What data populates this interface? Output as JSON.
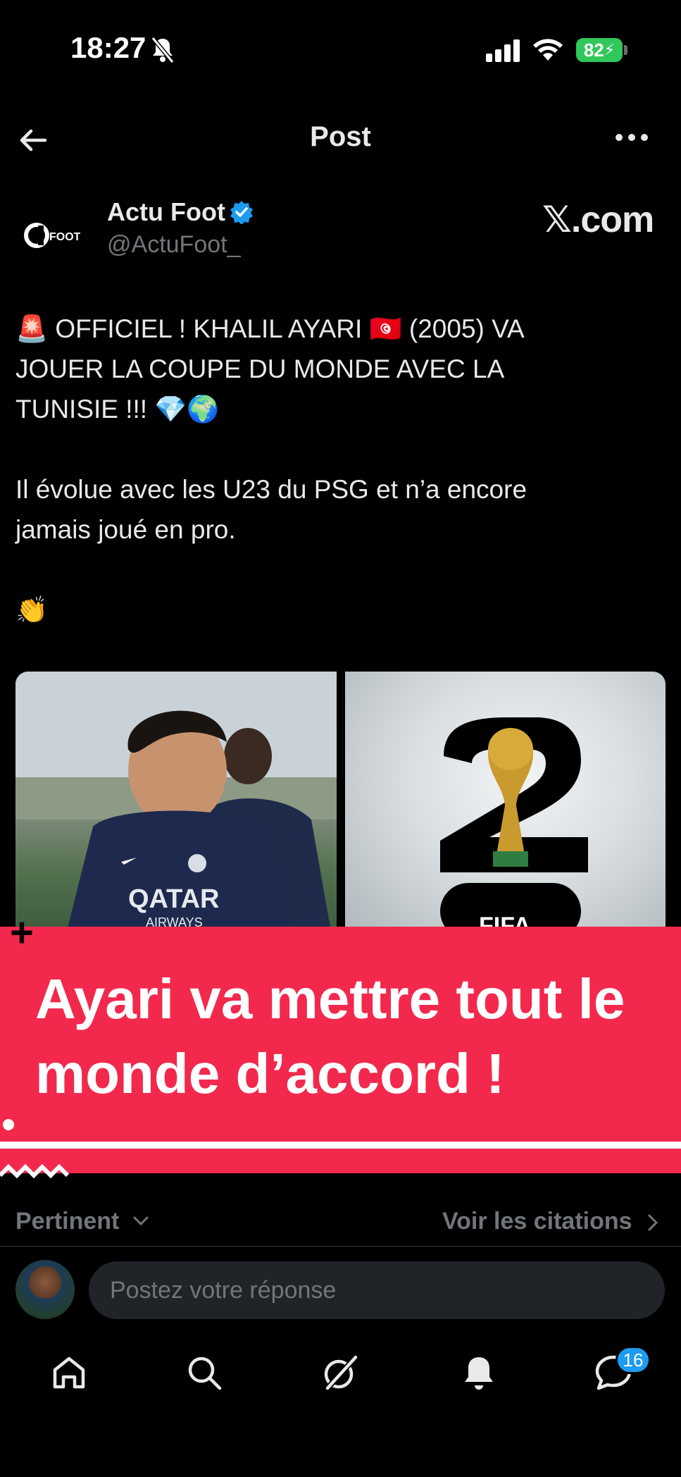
{
  "status_bar": {
    "time": "18:27",
    "battery": "82"
  },
  "header": {
    "title": "Post"
  },
  "author": {
    "name": "Actu Foot",
    "handle": "@ActuFoot_",
    "logo_text": "FOOT",
    "source": "𝕏.com"
  },
  "post": {
    "lines": [
      "🚨 OFFICIEL ! KHALIL AYARI 🇹🇳 (2005) VA",
      "JOUER LA COUPE DU MONDE AVEC LA",
      "TUNISIE !!! 💎🌍",
      "Il évolue avec les U23 du PSG et n’a encore",
      "jamais joué en pro.",
      "👏"
    ],
    "media": {
      "left_text": "QATAR",
      "left_subtext": "AIRWAYS",
      "right_text": "FIFA"
    }
  },
  "banner": {
    "text": "Ayari va mettre tout le monde d’accord !"
  },
  "sort": {
    "label": "Pertinent",
    "quotes_link": "Voir les citations"
  },
  "reply": {
    "placeholder": "Postez votre réponse"
  },
  "tabbar": {
    "messages_badge": "16"
  },
  "colors": {
    "accent": "#1d9bf0",
    "banner": "#f2294d",
    "battery": "#31c75a"
  }
}
